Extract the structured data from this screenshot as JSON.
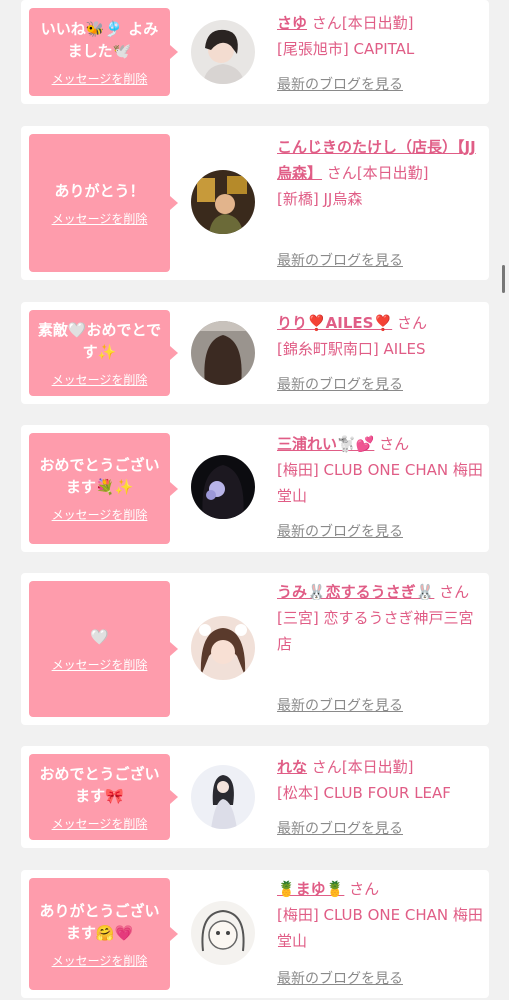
{
  "common": {
    "delete_label": "メッセージを削除",
    "blog_label": "最新のブログを見る",
    "san": "さん"
  },
  "cards": [
    {
      "message": "いいね🐝🎐 よみました🕊️",
      "name": "さゆ",
      "suffix": "[本日出勤]",
      "shop": "[尾張旭市] CAPITAL"
    },
    {
      "message": "ありがとう！",
      "name": "こんじきのたけし（店長）【JJ烏森】",
      "suffix": "[本日出勤]",
      "shop": "[新橋] JJ烏森"
    },
    {
      "message": "素敵🤍おめでとです✨",
      "name": "りり❣️AILES❣️",
      "suffix": "",
      "shop": "[錦糸町駅南口] AILES"
    },
    {
      "message": "おめでとうございます💐✨",
      "name": "三浦れい🐩💕",
      "suffix": "",
      "shop": "[梅田] CLUB ONE CHAN 梅田堂山"
    },
    {
      "message": "🤍",
      "name": "うみ🐰恋するうさぎ🐰",
      "suffix": "",
      "shop": "[三宮] 恋するうさぎ神戸三宮店"
    },
    {
      "message": "おめでとうございます🎀",
      "name": "れな",
      "suffix": "[本日出勤]",
      "shop": "[松本] CLUB FOUR LEAF"
    },
    {
      "message": "ありがとうございます🤗💗",
      "name": "🍍まゆ🍍",
      "suffix": "",
      "shop": "[梅田] CLUB ONE CHAN 梅田堂山"
    }
  ]
}
